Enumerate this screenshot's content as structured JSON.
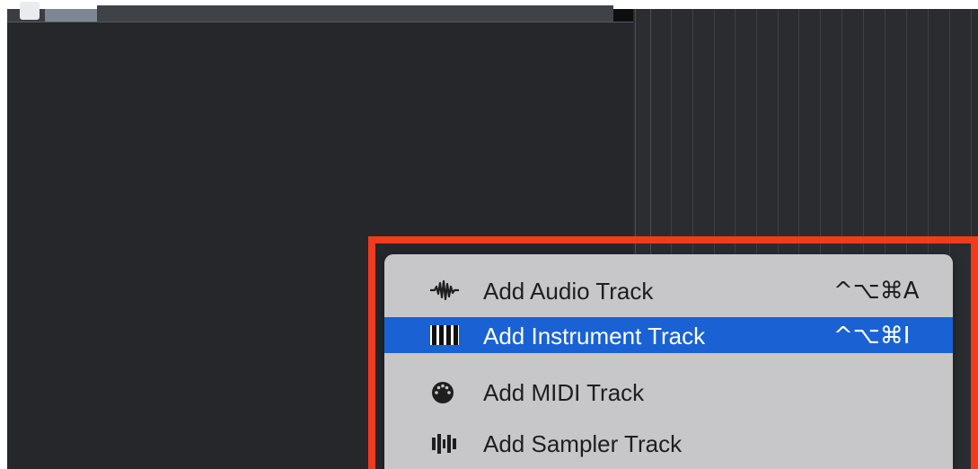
{
  "menu": {
    "items": [
      {
        "icon": "audio-waveform-icon",
        "label": "Add Audio Track",
        "shortcut": "^⌥⌘A",
        "selected": false
      },
      {
        "icon": "piano-keys-icon",
        "label": "Add Instrument Track",
        "shortcut": "^⌥⌘I",
        "selected": true
      },
      {
        "icon": "midi-connector-icon",
        "label": "Add MIDI Track",
        "shortcut": "",
        "selected": false
      },
      {
        "icon": "sampler-bars-icon",
        "label": "Add Sampler Track",
        "shortcut": "",
        "selected": false
      }
    ]
  },
  "colors": {
    "highlight_border": "#f23a1d",
    "menu_background": "#c7c7c9",
    "menu_selection": "#1a62d4",
    "panel_background": "#25272b"
  }
}
